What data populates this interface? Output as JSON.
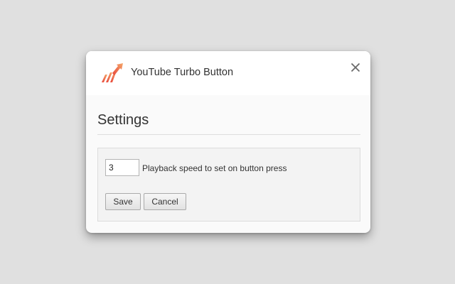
{
  "app": {
    "title": "YouTube Turbo Button",
    "logo_icon": "turbo-arrow-icon",
    "close_icon": "close-icon"
  },
  "settings": {
    "heading": "Settings",
    "speed_value": "3",
    "speed_label": "Playback speed to set on button press",
    "save_label": "Save",
    "cancel_label": "Cancel"
  },
  "colors": {
    "background": "#e0e0e0",
    "dialog": "#fafafa",
    "header": "#ffffff",
    "panel": "#f3f3f3",
    "logo_gradient_start": "#e8453a",
    "logo_gradient_end": "#f4a86a"
  }
}
